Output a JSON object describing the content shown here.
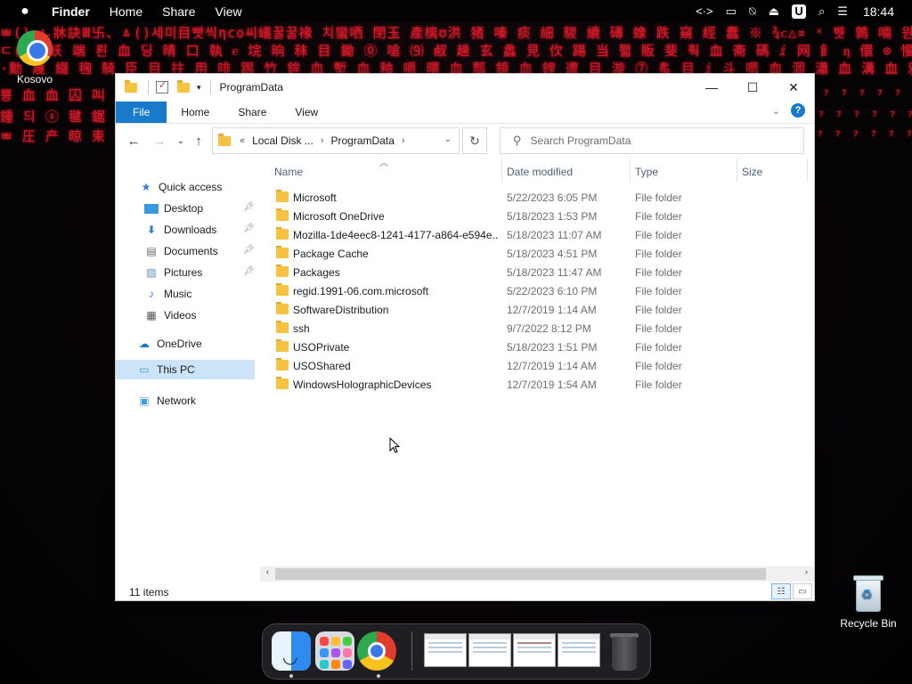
{
  "menubar": {
    "app_name": "Finder",
    "menus": [
      "Home",
      "Share",
      "View"
    ],
    "clock": "18:44"
  },
  "desktop": {
    "shortcut_label": "Kosovo",
    "recycle_bin_label": "Recycle Bin"
  },
  "window": {
    "title": "ProgramData",
    "ribbon_tabs": [
      "File",
      "Home",
      "Share",
      "View"
    ],
    "address": {
      "overflow": "«",
      "crumbs": [
        "Local Disk ...",
        "ProgramData"
      ]
    },
    "search_placeholder": "Search ProgramData",
    "columns": {
      "name": "Name",
      "date": "Date modified",
      "type": "Type",
      "size": "Size"
    },
    "sidebar": {
      "quick_access": "Quick access",
      "desktop": "Desktop",
      "downloads": "Downloads",
      "documents": "Documents",
      "pictures": "Pictures",
      "music": "Music",
      "videos": "Videos",
      "onedrive": "OneDrive",
      "this_pc": "This PC",
      "network": "Network"
    },
    "files": [
      {
        "name": "Microsoft",
        "date": "5/22/2023 6:05 PM",
        "type": "File folder"
      },
      {
        "name": "Microsoft OneDrive",
        "date": "5/18/2023 1:53 PM",
        "type": "File folder"
      },
      {
        "name": "Mozilla-1de4eec8-1241-4177-a864-e594e...",
        "date": "5/18/2023 11:07 AM",
        "type": "File folder"
      },
      {
        "name": "Package Cache",
        "date": "5/18/2023 4:51 PM",
        "type": "File folder"
      },
      {
        "name": "Packages",
        "date": "5/18/2023 11:47 AM",
        "type": "File folder"
      },
      {
        "name": "regid.1991-06.com.microsoft",
        "date": "5/22/2023 6:10 PM",
        "type": "File folder"
      },
      {
        "name": "SoftwareDistribution",
        "date": "12/7/2019 1:14 AM",
        "type": "File folder"
      },
      {
        "name": "ssh",
        "date": "9/7/2022 8:12 PM",
        "type": "File folder"
      },
      {
        "name": "USOPrivate",
        "date": "5/18/2023 1:51 PM",
        "type": "File folder"
      },
      {
        "name": "USOShared",
        "date": "12/7/2019 1:14 AM",
        "type": "File folder"
      },
      {
        "name": "WindowsHolographicDevices",
        "date": "12/7/2019 1:54 AM",
        "type": "File folder"
      }
    ],
    "status_count": "11 items"
  },
  "colors": {
    "accent": "#1979ca",
    "selection": "#cce4f7",
    "wallpaper_glyph": "#d8182a"
  },
  "icons": {
    "menubar": [
      "apple-icon",
      "code-icon",
      "display-icon",
      "no-signal-icon",
      "eject-icon",
      "user-u-icon",
      "search-icon",
      "control-center-icon"
    ]
  }
}
